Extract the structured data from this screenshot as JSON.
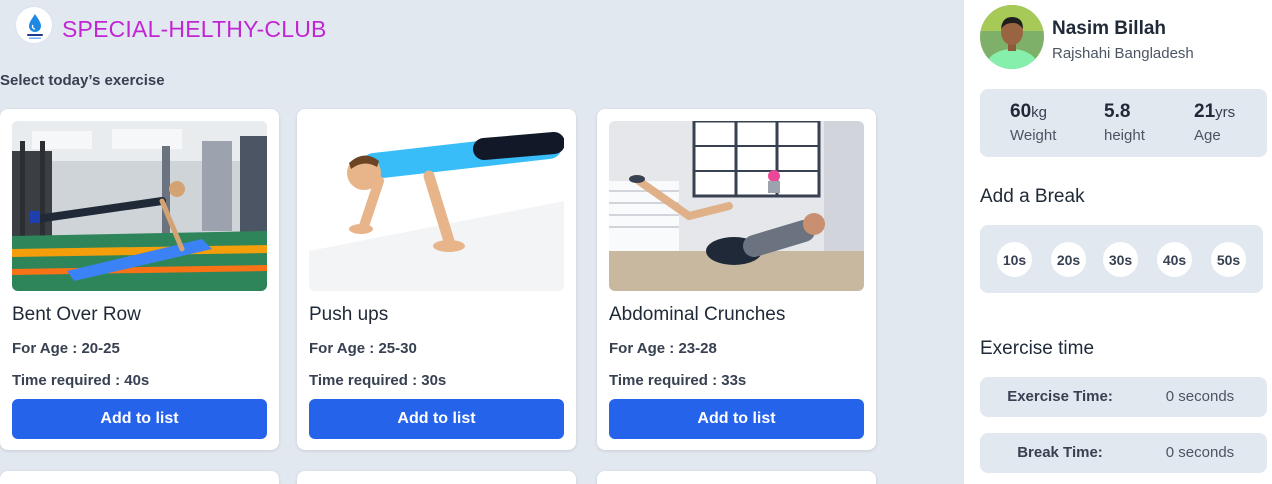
{
  "header": {
    "brand": "SPECIAL-HELTHY-CLUB",
    "logo_icon": "water-drop-icon"
  },
  "main": {
    "select_title": "Select today’s exercise",
    "exercises": [
      {
        "name": "Bent Over Row",
        "age": "For Age : 20-25",
        "time": "Time required : 40s",
        "button": "Add to list"
      },
      {
        "name": "Push ups",
        "age": "For Age : 25-30",
        "time": "Time required : 30s",
        "button": "Add to list"
      },
      {
        "name": "Abdominal Crunches",
        "age": "For Age : 23-28",
        "time": "Time required : 33s",
        "button": "Add to list"
      }
    ]
  },
  "sidebar": {
    "user": {
      "name": "Nasim Billah",
      "location": "Rajshahi Bangladesh"
    },
    "stats": [
      {
        "value": "60",
        "unit": "kg",
        "label": "Weight"
      },
      {
        "value": "5.8",
        "unit": "",
        "label": "height"
      },
      {
        "value": "21",
        "unit": "yrs",
        "label": "Age"
      }
    ],
    "break_title": "Add a Break",
    "breaks": [
      "10s",
      "20s",
      "30s",
      "40s",
      "50s"
    ],
    "exercise_title": "Exercise time",
    "exercise_time_label": "Exercise Time:",
    "exercise_time_value": "0 seconds",
    "break_time_label": "Break Time:",
    "break_time_value": "0 seconds"
  },
  "colors": {
    "accent": "#2563eb",
    "brand": "#c026d3",
    "background": "#e2e8f0"
  }
}
